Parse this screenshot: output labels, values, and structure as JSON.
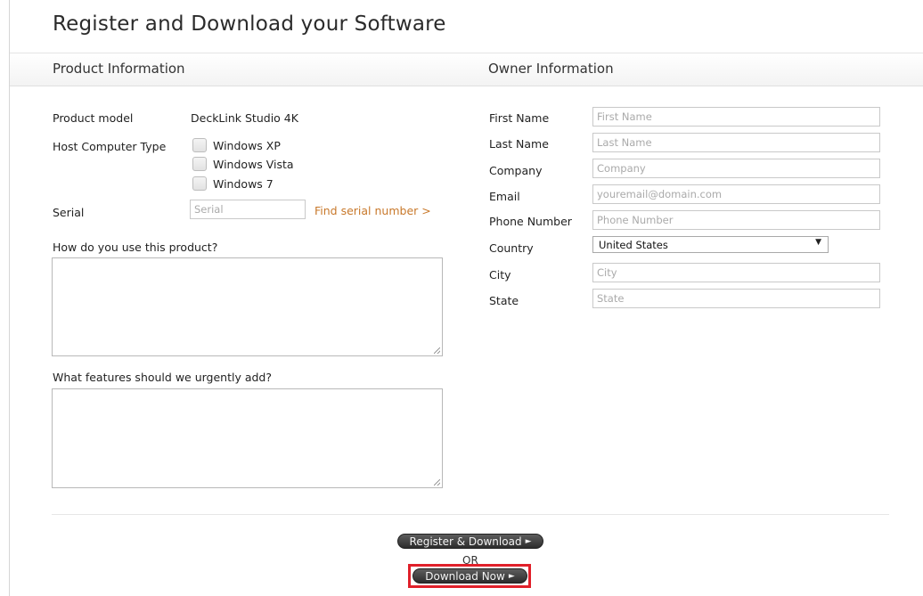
{
  "page": {
    "title": "Register and Download your Software"
  },
  "sections": {
    "product": "Product Information",
    "owner": "Owner Information"
  },
  "product": {
    "model_label": "Product model",
    "model_value": "DeckLink Studio 4K",
    "host_label": "Host Computer Type",
    "host_options": [
      "Windows XP",
      "Windows Vista",
      "Windows 7"
    ],
    "serial_label": "Serial",
    "serial_placeholder": "Serial",
    "find_serial_link": "Find serial number >",
    "usage_question": "How do you use this product?",
    "features_question": "What features should we urgently add?"
  },
  "owner": {
    "fields": [
      {
        "label": "First Name",
        "placeholder": "First Name"
      },
      {
        "label": "Last Name",
        "placeholder": "Last Name"
      },
      {
        "label": "Company",
        "placeholder": "Company"
      },
      {
        "label": "Email",
        "placeholder": "youremail@domain.com"
      },
      {
        "label": "Phone Number",
        "placeholder": "Phone Number"
      }
    ],
    "country_label": "Country",
    "country_value": "United States",
    "city_label": "City",
    "city_placeholder": "City",
    "state_label": "State",
    "state_placeholder": "State"
  },
  "actions": {
    "register_label": "Register & Download",
    "or_text": "OR",
    "download_label": "Download Now"
  },
  "colors": {
    "accent_link": "#c8782a",
    "highlight": "#e0202a",
    "button_dark": "#2c2c2c"
  }
}
